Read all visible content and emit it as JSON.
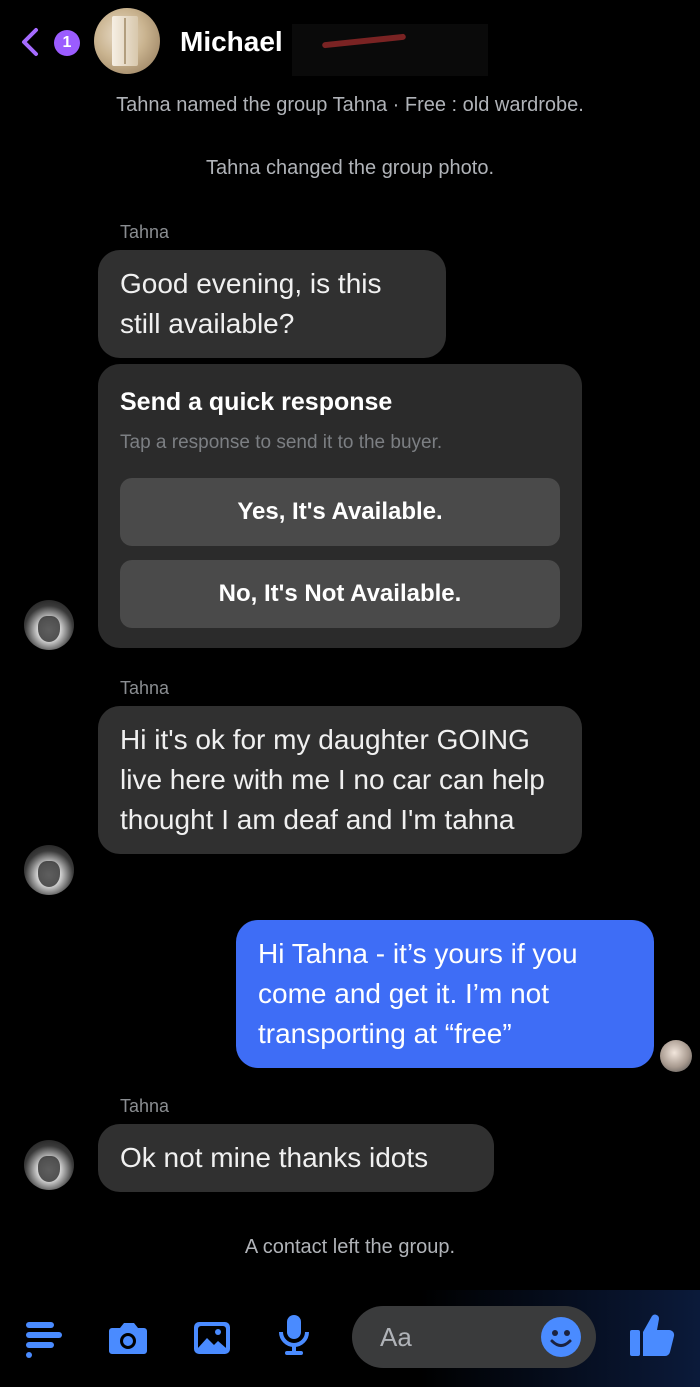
{
  "header": {
    "unread_count": "1",
    "chat_name": "Michael"
  },
  "notices": {
    "group_named": "Tahna named the group Tahna · Free : old wardrobe.",
    "group_photo": "Tahna changed the group photo.",
    "contact_left": "A contact left the group."
  },
  "messages": [
    {
      "sender": "Tahna",
      "text": "Good evening, is this still available?"
    },
    {
      "sender": "Tahna",
      "text": "Hi it's ok for my daughter GOING live here with me I no car can help thought I am deaf and I'm tahna"
    },
    {
      "sender": "",
      "text": "Hi Tahna - it’s yours if you come and get it.  I’m not transporting at “free”"
    },
    {
      "sender": "Tahna",
      "text": "Ok not mine thanks idots"
    }
  ],
  "quick_response": {
    "title": "Send a quick response",
    "subtitle": "Tap a response to send it to the buyer.",
    "options": [
      "Yes, It's Available.",
      "No, It's Not Available."
    ]
  },
  "composer": {
    "placeholder": "Aa"
  },
  "colors": {
    "background": "#000000",
    "incoming_bubble": "#303030",
    "outgoing_bubble": "#3e6df6",
    "accent": "#4a8bff",
    "badge": "#9b5cff"
  },
  "icons": [
    "back-chevron-icon",
    "menu-icon",
    "camera-icon",
    "image-icon",
    "microphone-icon",
    "emoji-icon",
    "thumbs-up-icon"
  ]
}
